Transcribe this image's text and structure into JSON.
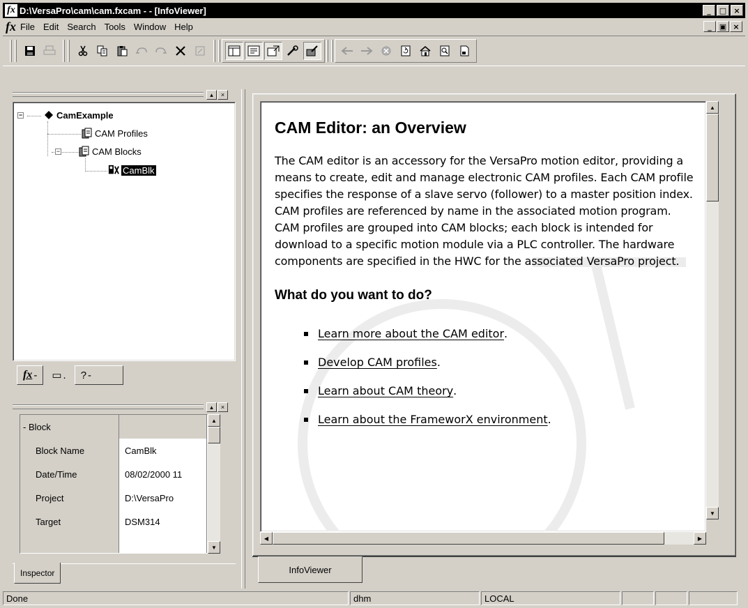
{
  "window": {
    "title": "D:\\VersaPro\\cam\\cam.fxcam - - [InfoViewer]",
    "app_icon": "fx",
    "minimize": "_",
    "maximize": "□",
    "close": "×",
    "restore": "▣"
  },
  "menu": {
    "icon": "fx",
    "items": [
      "File",
      "Edit",
      "Search",
      "Tools",
      "Window",
      "Help"
    ]
  },
  "toolbar": {
    "icons": [
      "save-icon",
      "print-icon",
      "cut-icon",
      "copy-icon",
      "paste-icon",
      "undo-icon",
      "redo-icon",
      "delete-icon",
      "properties-icon",
      "tree-view-icon",
      "infoviewer-icon",
      "inspector-icon",
      "tool-icon",
      "editor-icon",
      "back-arrow-icon",
      "forward-arrow-icon",
      "stop-icon",
      "refresh-icon",
      "home-icon",
      "search-page-icon",
      "bookmark-icon"
    ]
  },
  "tree": {
    "root": "CamExample",
    "children": [
      {
        "label": "CAM Profiles"
      },
      {
        "label": "CAM Blocks",
        "children": [
          {
            "label": "CamBlk",
            "selected": true
          }
        ]
      }
    ],
    "expand_glyph": "−"
  },
  "left_tabs": [
    {
      "label": "fx",
      "glyph": "-"
    },
    {
      "label": "▭",
      "glyph": "."
    },
    {
      "label": "?",
      "glyph": "-"
    }
  ],
  "inspector": {
    "category": "- Block",
    "rows": [
      {
        "name": "Block Name",
        "value": "CamBlk"
      },
      {
        "name": "Date/Time",
        "value": "08/02/2000 11"
      },
      {
        "name": "Project",
        "value": "D:\\VersaPro"
      },
      {
        "name": "Target",
        "value": "DSM314"
      }
    ],
    "tab": "Inspector"
  },
  "content": {
    "title": "CAM Editor: an Overview",
    "paragraph": "The CAM editor is an accessory for the VersaPro motion editor, providing a means to create, edit and manage electronic CAM profiles. Each CAM profile specifies the response of a slave servo (follower) to a master position index. CAM profiles are referenced by name in the associated motion program. CAM profiles are grouped into CAM blocks; each block is intended for download to a specific motion module via a PLC controller. The hardware components are specified in the HWC for the associated VersaPro project.",
    "subtitle": "What do you want to do?",
    "links": [
      "Learn more about the CAM editor",
      "Develop CAM profiles",
      "Learn about CAM theory",
      "Learn about the FrameworX environment"
    ],
    "link_suffix": "."
  },
  "viewer_tab": "InfoViewer",
  "status": {
    "message": "Done",
    "user": "dhm",
    "mode": "LOCAL"
  }
}
